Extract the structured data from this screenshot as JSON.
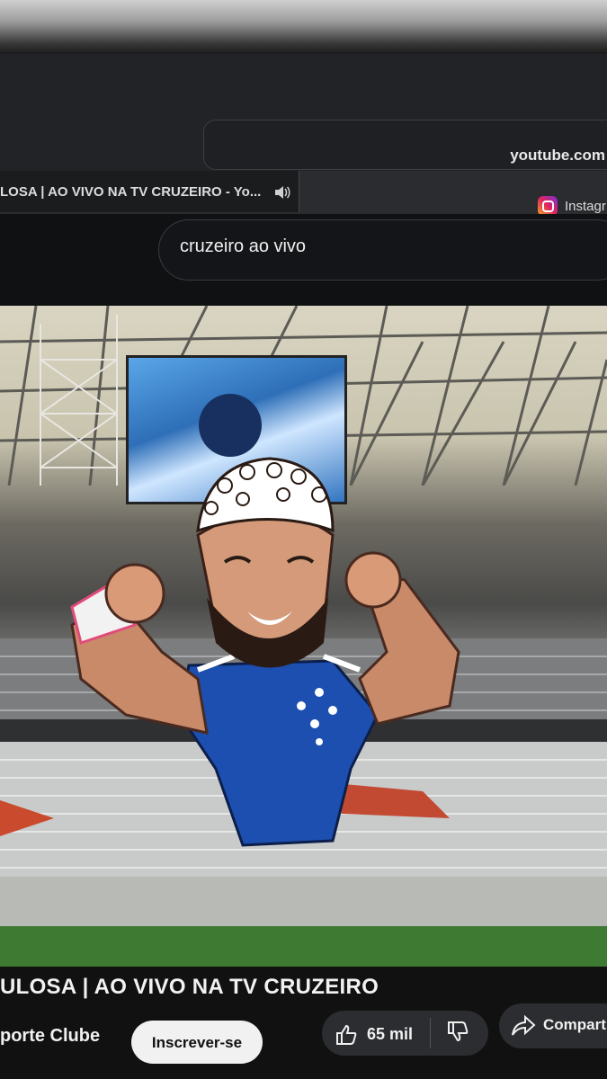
{
  "browser": {
    "address_text": "youtube.com",
    "active_tab_title": "LOSA | AO VIVO NA TV CRUZEIRO - Yo...",
    "second_tab_title": "Instagr"
  },
  "youtube": {
    "search_query": "cruzeiro ao vivo",
    "video_title": "ULOSA | AO VIVO NA TV CRUZEIRO",
    "channel_name": "porte Clube",
    "subscribe_label": "Inscrever-se",
    "like_count": "65 mil",
    "share_label": "Comparti"
  },
  "colors": {
    "page_background": "#111111",
    "subscribe_button": "#f1f1f1",
    "action_pill": "#2c2d30",
    "jersey_blue": "#1d4fb0"
  },
  "icons": [
    "speaker-icon",
    "instagram-icon",
    "like-icon",
    "dislike-icon",
    "share-icon"
  ]
}
